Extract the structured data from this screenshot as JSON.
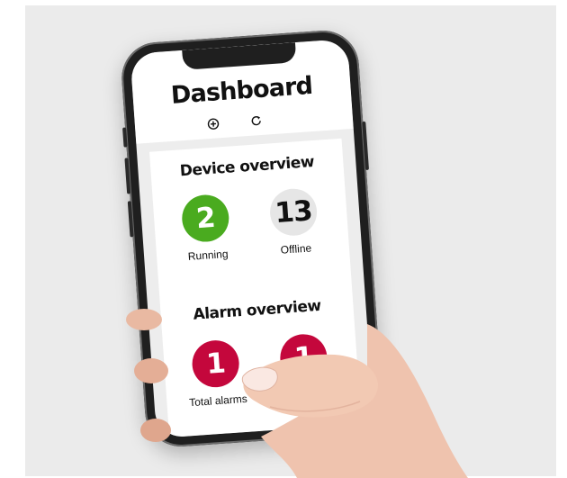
{
  "colors": {
    "running": "#4aab1f",
    "offline": "#e6e6e6",
    "alarm": "#c4073c"
  },
  "header": {
    "title": "Dashboard",
    "icons": [
      "add-circle-icon",
      "refresh-icon"
    ]
  },
  "device_overview": {
    "title": "Device overview",
    "running": {
      "count": "2",
      "label": "Running"
    },
    "offline": {
      "count": "13",
      "label": "Offline"
    }
  },
  "alarm_overview": {
    "title": "Alarm overview",
    "total": {
      "count": "1",
      "label": "Total alarms"
    },
    "second": {
      "count": "1"
    }
  }
}
